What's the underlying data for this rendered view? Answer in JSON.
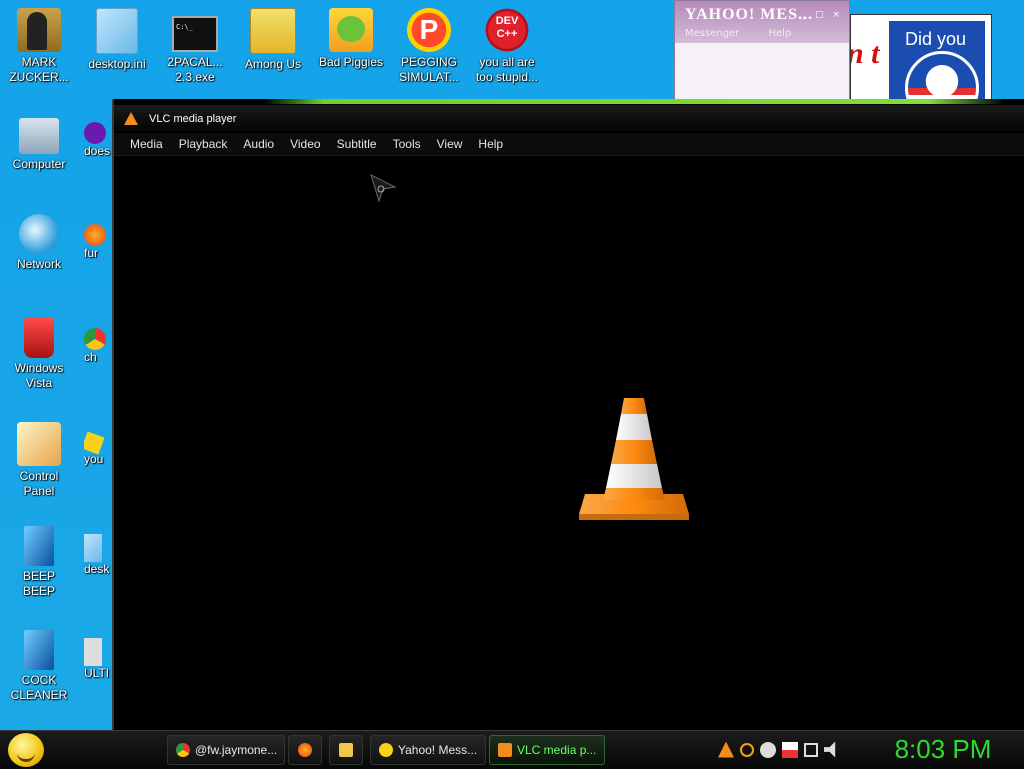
{
  "desktop": {
    "icons_col1": [
      {
        "label": "MARK\nZUCKER..."
      },
      {
        "label": "Computer"
      },
      {
        "label": "Network"
      },
      {
        "label": "Windows\nVista"
      },
      {
        "label": "Control\nPanel"
      },
      {
        "label": "BEEP\nBEEP"
      },
      {
        "label": "COCK\nCLEANER"
      }
    ],
    "icons_row1": [
      {
        "label": "desktop.ini"
      },
      {
        "label": "2PACAL...\n2.3.exe"
      },
      {
        "label": "Among Us"
      },
      {
        "label": "Bad Piggies"
      },
      {
        "label": "PEGGING\nSIMULAT..."
      },
      {
        "label": "you all are\ntoo stupid..."
      }
    ],
    "icons_col2_cut": [
      {
        "label": "does"
      },
      {
        "label": "fur"
      },
      {
        "label": "ch"
      },
      {
        "label": "you"
      },
      {
        "label": "desk"
      },
      {
        "label": "ULTI\nBLO"
      }
    ]
  },
  "yahoo_window": {
    "logo": "YAHOO! MES...",
    "menu": [
      "Messenger",
      "Help"
    ]
  },
  "image_window": {
    "partial_text": "n t",
    "banner_text": "Did you"
  },
  "vlc": {
    "title": "VLC media player",
    "menu": [
      "Media",
      "Playback",
      "Audio",
      "Video",
      "Subtitle",
      "Tools",
      "View",
      "Help"
    ]
  },
  "taskbar": {
    "buttons": [
      {
        "label": "@fw.jaymone..."
      },
      {
        "label": "Yahoo! Mess..."
      },
      {
        "label": "VLC media p..."
      }
    ],
    "clock": "8:03 PM"
  },
  "colors": {
    "desktop_bg": "#1aa6e8",
    "vlc_orange": "#f28c1a",
    "clock_green": "#2ddc2d"
  }
}
